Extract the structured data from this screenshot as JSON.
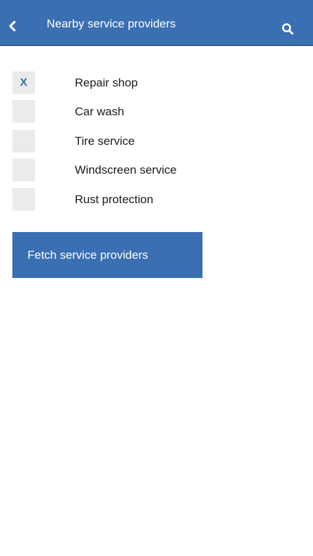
{
  "header": {
    "title": "Nearby service providers",
    "back_icon": "chevron-left-icon",
    "search_icon": "search-icon",
    "background_color": "#3a6fb2",
    "text_color": "#ffffff"
  },
  "options": [
    {
      "label": "Repair shop",
      "checked": true,
      "mark": "X"
    },
    {
      "label": "Car wash",
      "checked": false,
      "mark": ""
    },
    {
      "label": "Tire service",
      "checked": false,
      "mark": ""
    },
    {
      "label": "Windscreen service",
      "checked": false,
      "mark": ""
    },
    {
      "label": "Rust protection",
      "checked": false,
      "mark": ""
    }
  ],
  "actions": {
    "fetch_label": "Fetch service providers",
    "button_color": "#3a6fb2"
  }
}
